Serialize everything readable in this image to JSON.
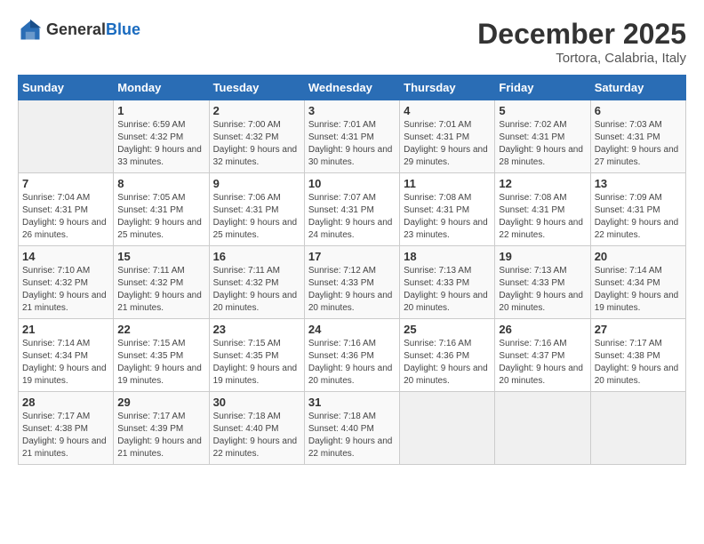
{
  "header": {
    "logo_general": "General",
    "logo_blue": "Blue",
    "month_year": "December 2025",
    "location": "Tortora, Calabria, Italy"
  },
  "columns": [
    "Sunday",
    "Monday",
    "Tuesday",
    "Wednesday",
    "Thursday",
    "Friday",
    "Saturday"
  ],
  "weeks": [
    [
      {
        "day": "",
        "sunrise": "",
        "sunset": "",
        "daylight": ""
      },
      {
        "day": "1",
        "sunrise": "6:59 AM",
        "sunset": "4:32 PM",
        "daylight": "9 hours and 33 minutes."
      },
      {
        "day": "2",
        "sunrise": "7:00 AM",
        "sunset": "4:32 PM",
        "daylight": "9 hours and 32 minutes."
      },
      {
        "day": "3",
        "sunrise": "7:01 AM",
        "sunset": "4:31 PM",
        "daylight": "9 hours and 30 minutes."
      },
      {
        "day": "4",
        "sunrise": "7:01 AM",
        "sunset": "4:31 PM",
        "daylight": "9 hours and 29 minutes."
      },
      {
        "day": "5",
        "sunrise": "7:02 AM",
        "sunset": "4:31 PM",
        "daylight": "9 hours and 28 minutes."
      },
      {
        "day": "6",
        "sunrise": "7:03 AM",
        "sunset": "4:31 PM",
        "daylight": "9 hours and 27 minutes."
      }
    ],
    [
      {
        "day": "7",
        "sunrise": "7:04 AM",
        "sunset": "4:31 PM",
        "daylight": "9 hours and 26 minutes."
      },
      {
        "day": "8",
        "sunrise": "7:05 AM",
        "sunset": "4:31 PM",
        "daylight": "9 hours and 25 minutes."
      },
      {
        "day": "9",
        "sunrise": "7:06 AM",
        "sunset": "4:31 PM",
        "daylight": "9 hours and 25 minutes."
      },
      {
        "day": "10",
        "sunrise": "7:07 AM",
        "sunset": "4:31 PM",
        "daylight": "9 hours and 24 minutes."
      },
      {
        "day": "11",
        "sunrise": "7:08 AM",
        "sunset": "4:31 PM",
        "daylight": "9 hours and 23 minutes."
      },
      {
        "day": "12",
        "sunrise": "7:08 AM",
        "sunset": "4:31 PM",
        "daylight": "9 hours and 22 minutes."
      },
      {
        "day": "13",
        "sunrise": "7:09 AM",
        "sunset": "4:31 PM",
        "daylight": "9 hours and 22 minutes."
      }
    ],
    [
      {
        "day": "14",
        "sunrise": "7:10 AM",
        "sunset": "4:32 PM",
        "daylight": "9 hours and 21 minutes."
      },
      {
        "day": "15",
        "sunrise": "7:11 AM",
        "sunset": "4:32 PM",
        "daylight": "9 hours and 21 minutes."
      },
      {
        "day": "16",
        "sunrise": "7:11 AM",
        "sunset": "4:32 PM",
        "daylight": "9 hours and 20 minutes."
      },
      {
        "day": "17",
        "sunrise": "7:12 AM",
        "sunset": "4:33 PM",
        "daylight": "9 hours and 20 minutes."
      },
      {
        "day": "18",
        "sunrise": "7:13 AM",
        "sunset": "4:33 PM",
        "daylight": "9 hours and 20 minutes."
      },
      {
        "day": "19",
        "sunrise": "7:13 AM",
        "sunset": "4:33 PM",
        "daylight": "9 hours and 20 minutes."
      },
      {
        "day": "20",
        "sunrise": "7:14 AM",
        "sunset": "4:34 PM",
        "daylight": "9 hours and 19 minutes."
      }
    ],
    [
      {
        "day": "21",
        "sunrise": "7:14 AM",
        "sunset": "4:34 PM",
        "daylight": "9 hours and 19 minutes."
      },
      {
        "day": "22",
        "sunrise": "7:15 AM",
        "sunset": "4:35 PM",
        "daylight": "9 hours and 19 minutes."
      },
      {
        "day": "23",
        "sunrise": "7:15 AM",
        "sunset": "4:35 PM",
        "daylight": "9 hours and 19 minutes."
      },
      {
        "day": "24",
        "sunrise": "7:16 AM",
        "sunset": "4:36 PM",
        "daylight": "9 hours and 20 minutes."
      },
      {
        "day": "25",
        "sunrise": "7:16 AM",
        "sunset": "4:36 PM",
        "daylight": "9 hours and 20 minutes."
      },
      {
        "day": "26",
        "sunrise": "7:16 AM",
        "sunset": "4:37 PM",
        "daylight": "9 hours and 20 minutes."
      },
      {
        "day": "27",
        "sunrise": "7:17 AM",
        "sunset": "4:38 PM",
        "daylight": "9 hours and 20 minutes."
      }
    ],
    [
      {
        "day": "28",
        "sunrise": "7:17 AM",
        "sunset": "4:38 PM",
        "daylight": "9 hours and 21 minutes."
      },
      {
        "day": "29",
        "sunrise": "7:17 AM",
        "sunset": "4:39 PM",
        "daylight": "9 hours and 21 minutes."
      },
      {
        "day": "30",
        "sunrise": "7:18 AM",
        "sunset": "4:40 PM",
        "daylight": "9 hours and 22 minutes."
      },
      {
        "day": "31",
        "sunrise": "7:18 AM",
        "sunset": "4:40 PM",
        "daylight": "9 hours and 22 minutes."
      },
      {
        "day": "",
        "sunrise": "",
        "sunset": "",
        "daylight": ""
      },
      {
        "day": "",
        "sunrise": "",
        "sunset": "",
        "daylight": ""
      },
      {
        "day": "",
        "sunrise": "",
        "sunset": "",
        "daylight": ""
      }
    ]
  ],
  "labels": {
    "sunrise": "Sunrise:",
    "sunset": "Sunset:",
    "daylight": "Daylight:"
  }
}
